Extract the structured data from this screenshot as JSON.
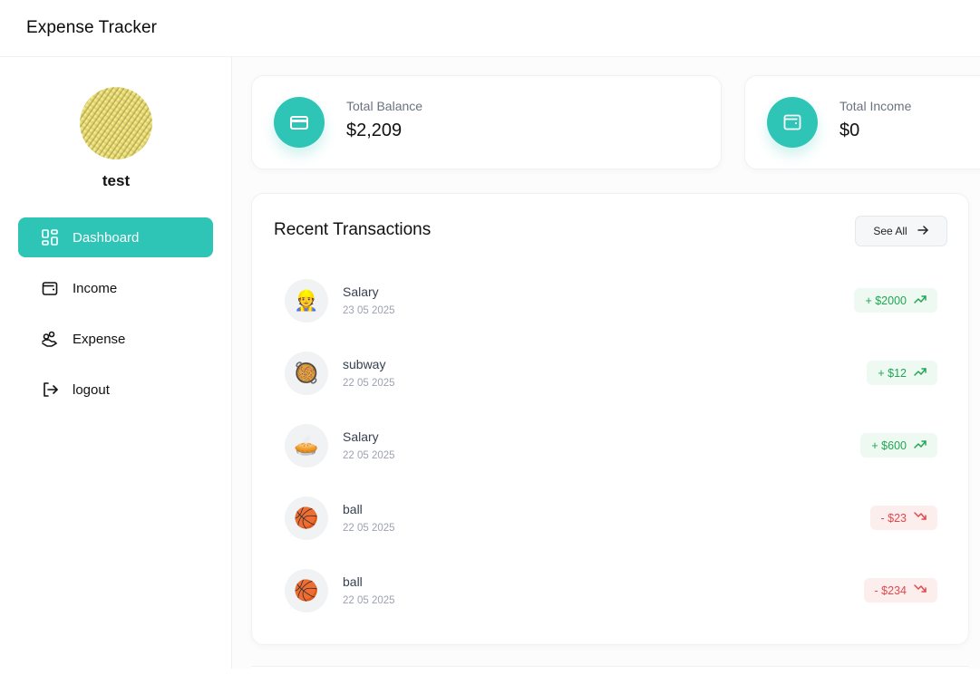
{
  "app": {
    "title": "Expense Tracker"
  },
  "user": {
    "name": "test"
  },
  "sidebar": {
    "items": [
      {
        "label": "Dashboard",
        "icon": "dashboard-icon",
        "active": true
      },
      {
        "label": "Income",
        "icon": "wallet-icon"
      },
      {
        "label": "Expense",
        "icon": "hand-coins-icon"
      },
      {
        "label": "logout",
        "icon": "logout-icon"
      }
    ]
  },
  "stats": [
    {
      "label": "Total Balance",
      "value": "$2,209",
      "icon": "credit-card-icon"
    },
    {
      "label": "Total Income",
      "value": "$0",
      "icon": "wallet-icon"
    }
  ],
  "transactions": {
    "title": "Recent Transactions",
    "see_all_label": "See All",
    "items": [
      {
        "emoji": "👷",
        "name": "Salary",
        "date": "23 05 2025",
        "amount": "+ $2000",
        "type": "income"
      },
      {
        "emoji": "🥘",
        "name": "subway",
        "date": "22 05 2025",
        "amount": "+ $12",
        "type": "income"
      },
      {
        "emoji": "🥧",
        "name": "Salary",
        "date": "22 05 2025",
        "amount": "+ $600",
        "type": "income"
      },
      {
        "emoji": "🏀",
        "name": "ball",
        "date": "22 05 2025",
        "amount": "- $23",
        "type": "expense"
      },
      {
        "emoji": "🏀",
        "name": "ball",
        "date": "22 05 2025",
        "amount": "- $234",
        "type": "expense"
      }
    ]
  },
  "colors": {
    "accent": "#2ec4b6",
    "income": "#22a556",
    "expense": "#e0484e"
  }
}
